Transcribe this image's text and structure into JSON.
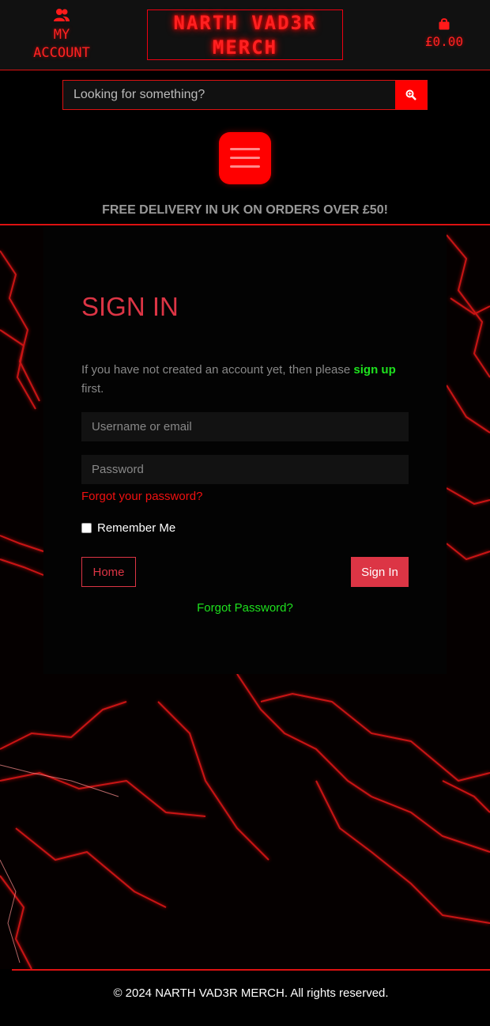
{
  "header": {
    "account_label_line1": "MY",
    "account_label_line2": "ACCOUNT",
    "logo_line1": "NARTH VAD3R",
    "logo_line2": "MERCH",
    "cart_total": "£0.00"
  },
  "search": {
    "placeholder": "Looking for something?"
  },
  "banner": {
    "delivery_text": "FREE DELIVERY IN UK ON ORDERS OVER £50!"
  },
  "signin": {
    "title": "SIGN IN",
    "intro_before": "If you have not created an account yet, then please ",
    "intro_link": "sign up",
    "intro_after": " first.",
    "username_placeholder": "Username or email",
    "password_placeholder": "Password",
    "forgot_link": "Forgot your password?",
    "remember_label": "Remember Me",
    "home_button": "Home",
    "signin_button": "Sign In",
    "forgot_bottom": "Forgot Password?"
  },
  "footer": {
    "copyright": "© 2024 NARTH VAD3R MERCH. All rights reserved."
  },
  "colors": {
    "accent_red": "#ff0000",
    "signin_red": "#dc3545",
    "link_green": "#1ee21e"
  },
  "icons": [
    "users-icon",
    "shopping-bag-icon",
    "search-icon",
    "hamburger-menu-icon"
  ]
}
